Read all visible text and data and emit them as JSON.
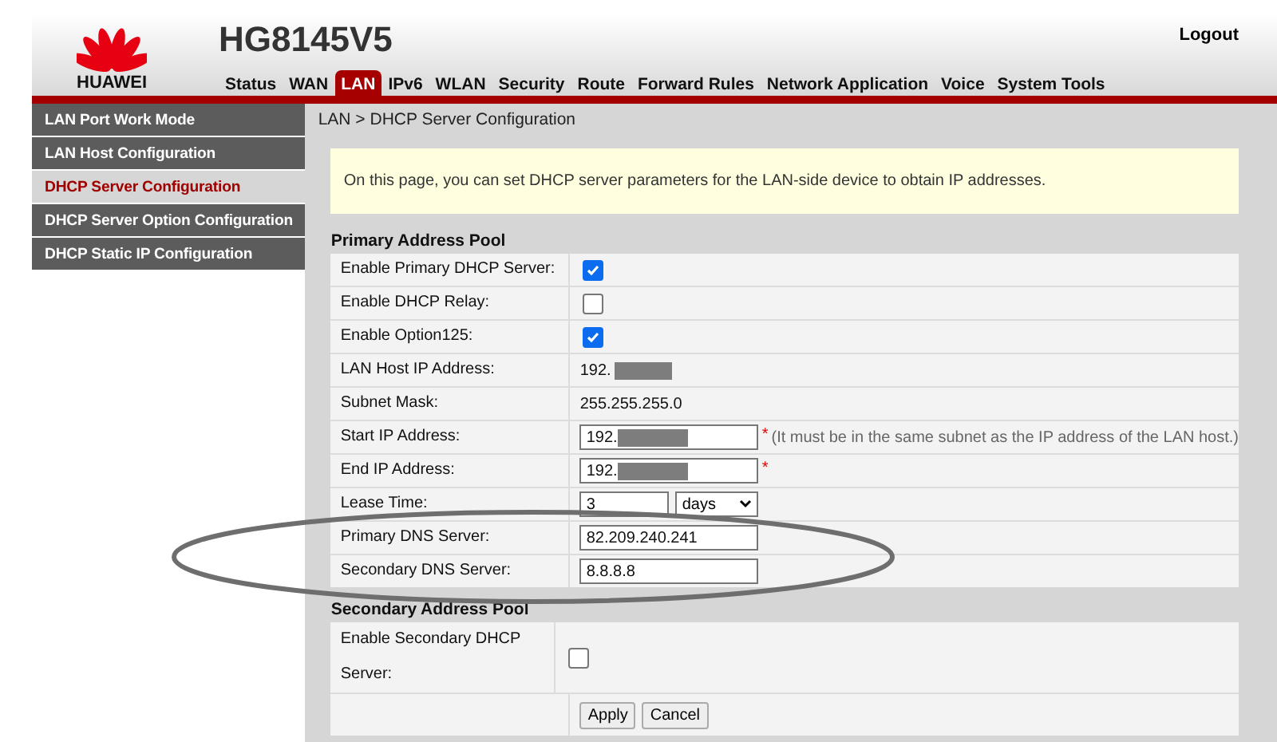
{
  "header": {
    "brand": "HUAWEI",
    "model": "HG8145V5",
    "logout": "Logout"
  },
  "nav": [
    {
      "label": "Status",
      "selected": false
    },
    {
      "label": "WAN",
      "selected": false
    },
    {
      "label": "LAN",
      "selected": true
    },
    {
      "label": "IPv6",
      "selected": false
    },
    {
      "label": "WLAN",
      "selected": false
    },
    {
      "label": "Security",
      "selected": false
    },
    {
      "label": "Route",
      "selected": false
    },
    {
      "label": "Forward Rules",
      "selected": false
    },
    {
      "label": "Network Application",
      "selected": false
    },
    {
      "label": "Voice",
      "selected": false
    },
    {
      "label": "System Tools",
      "selected": false
    }
  ],
  "sidebar": {
    "items": [
      {
        "label": "LAN Port Work Mode",
        "selected": false
      },
      {
        "label": "LAN Host Configuration",
        "selected": false
      },
      {
        "label": "DHCP Server Configuration",
        "selected": true
      },
      {
        "label": "DHCP Server Option Configuration",
        "selected": false
      },
      {
        "label": "DHCP Static IP Configuration",
        "selected": false
      }
    ]
  },
  "breadcrumb": "LAN > DHCP Server Configuration",
  "notice": "On this page, you can set DHCP server parameters for the LAN-side device to obtain IP addresses.",
  "primary_pool": {
    "title": "Primary Address Pool",
    "rows": [
      {
        "kind": "checkbox",
        "label": "Enable Primary DHCP Server:",
        "checked": true
      },
      {
        "kind": "checkbox",
        "label": "Enable DHCP Relay:",
        "checked": false
      },
      {
        "kind": "checkbox",
        "label": "Enable Option125:",
        "checked": true
      },
      {
        "kind": "text",
        "label": "LAN Host IP Address:",
        "value": "192.",
        "redacted": true
      },
      {
        "kind": "text",
        "label": "Subnet Mask:",
        "value": "255.255.255.0",
        "redacted": false
      },
      {
        "kind": "input",
        "label": "Start IP Address:",
        "value": "192.",
        "redacted": true,
        "required": true,
        "hint": "(It must be in the same subnet as the IP address of the LAN host.)"
      },
      {
        "kind": "input",
        "label": "End IP Address:",
        "value": "192.",
        "redacted": true,
        "required": true
      },
      {
        "kind": "lease",
        "label": "Lease Time:",
        "value": "3",
        "unit": "days"
      },
      {
        "kind": "input",
        "label": "Primary DNS Server:",
        "value": "82.209.240.241",
        "redacted": false,
        "required": false
      },
      {
        "kind": "input",
        "label": "Secondary DNS Server:",
        "value": "8.8.8.8",
        "redacted": false,
        "required": false
      }
    ]
  },
  "secondary_pool": {
    "title": "Secondary Address Pool",
    "rows": [
      {
        "kind": "checkbox",
        "label": "Enable Secondary DHCP Server:",
        "checked": false
      }
    ]
  },
  "buttons": [
    "Apply",
    "Cancel"
  ],
  "required_mark": "*"
}
